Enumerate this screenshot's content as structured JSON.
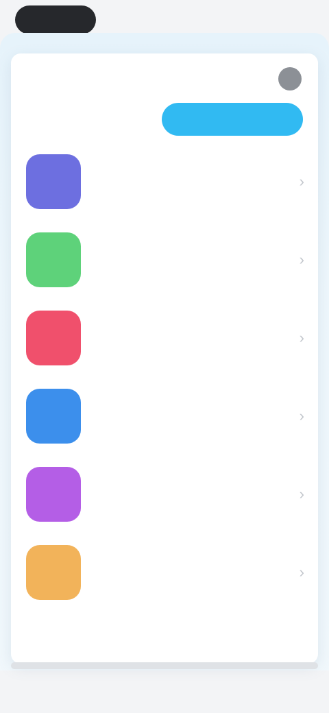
{
  "header": {
    "title": "",
    "subtitle": "",
    "primary_button_label": ""
  },
  "items": [
    {
      "title": "",
      "description": "",
      "color": "#6d6fe0",
      "icon": "app-icon-1"
    },
    {
      "title": "",
      "description": "",
      "color": "#5ed27a",
      "icon": "app-icon-2"
    },
    {
      "title": "",
      "description": "",
      "color": "#f0506c",
      "icon": "app-icon-3"
    },
    {
      "title": "",
      "description": "",
      "color": "#3c8fec",
      "icon": "app-icon-4"
    },
    {
      "title": "",
      "description": "",
      "color": "#b45ee6",
      "icon": "app-icon-5"
    },
    {
      "title": "",
      "description": "",
      "color": "#f2b35a",
      "icon": "app-icon-6"
    }
  ],
  "colors": {
    "accent": "#31baf2",
    "background": "#e6f3fb"
  }
}
